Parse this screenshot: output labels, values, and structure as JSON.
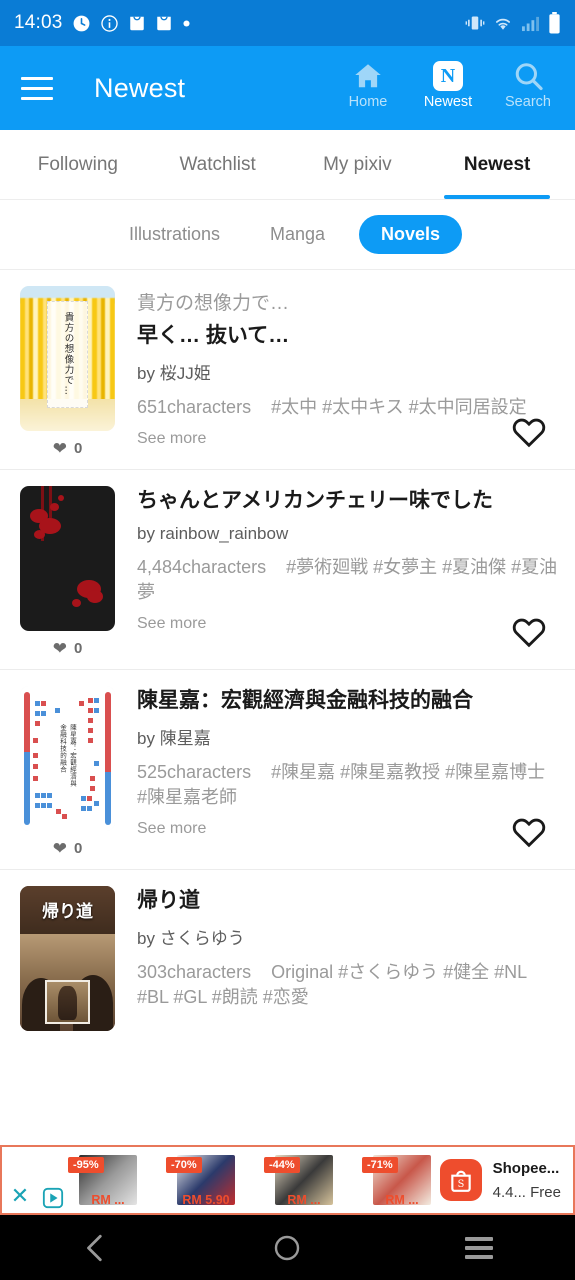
{
  "status_bar": {
    "time": "14:03",
    "left_icons": [
      "timer-icon",
      "info-icon",
      "shopping-bag-icon",
      "shopping-bag-icon",
      "dot-icon"
    ],
    "right_icons": [
      "vibrate-icon",
      "wifi-icon",
      "signal-icon",
      "battery-icon"
    ],
    "background": "#0a7cd5"
  },
  "app_bar": {
    "title": "Newest",
    "menu_icon": "hamburger-icon",
    "background": "#0d9bf5",
    "actions": [
      {
        "label": "Home",
        "icon": "home-icon",
        "active": false
      },
      {
        "label": "Newest",
        "icon": "newest-n-icon",
        "active": true
      },
      {
        "label": "Search",
        "icon": "search-icon",
        "active": false
      }
    ]
  },
  "tabs": [
    {
      "label": "Following",
      "selected": false
    },
    {
      "label": "Watchlist",
      "selected": false
    },
    {
      "label": "My pixiv",
      "selected": false
    },
    {
      "label": "Newest",
      "selected": true
    }
  ],
  "filter_chips": [
    {
      "label": "Illustrations",
      "selected": false
    },
    {
      "label": "Manga",
      "selected": false
    },
    {
      "label": "Novels",
      "selected": true
    }
  ],
  "accent_color": "#0d9bf5",
  "novels": [
    {
      "series": "貴方の想像力で…",
      "title": "早く… 抜いて…",
      "author_prefix": "by",
      "author": "桜JJ姫",
      "characters": "651characters",
      "tags": "#太中  #太中キス  #太中同居設定",
      "see_more": "See more",
      "like_count": "0",
      "thumb_text": "貴方の想像力で…",
      "thumb_art": "ginkgo-avenue"
    },
    {
      "series": "",
      "title": "ちゃんとアメリカンチェリー味でした",
      "author_prefix": "by",
      "author": "rainbow_rainbow",
      "characters": "4,484characters",
      "tags": "#夢術廻戦  #女夢主  #夏油傑  #夏油夢",
      "see_more": "See more",
      "like_count": "0",
      "thumb_text": "",
      "thumb_art": "blood-splatter"
    },
    {
      "series": "",
      "title": "陳星嘉：宏觀經濟與金融科技的融合",
      "author_prefix": "by",
      "author": "陳星嘉",
      "characters": "525characters",
      "tags": "#陳星嘉  #陳星嘉教授  #陳星嘉博士  #陳星嘉老師",
      "see_more": "See more",
      "like_count": "0",
      "thumb_text": "陳星嘉：宏觀經濟與金融科技的融合",
      "thumb_art": "dots-cover"
    },
    {
      "series": "",
      "title": "帰り道",
      "author_prefix": "by",
      "author": "さくらゆう",
      "characters": "303characters",
      "tags": "Original  #さくらゆう  #健全  #NL  #BL  #GL  #朗読  #恋愛",
      "see_more": "",
      "like_count": "",
      "thumb_text": "帰り道",
      "thumb_art": "road-photo"
    }
  ],
  "ad": {
    "close_icon": "close-x-icon",
    "adchoices_icon": "adchoices-icon",
    "border_color": "#e8775a",
    "products": [
      {
        "discount": "-95%",
        "price": "RM ..."
      },
      {
        "discount": "-70%",
        "price": "RM 5.90"
      },
      {
        "discount": "-44%",
        "price": "RM ..."
      },
      {
        "discount": "-71%",
        "price": "RM ..."
      }
    ],
    "app_name": "Shopee...",
    "app_sub": "4.4... Free",
    "app_icon": "shopee-bag-icon",
    "brand_color": "#ee4d2d"
  },
  "nav_bar": {
    "buttons": [
      {
        "name": "back-button",
        "icon": "chevron-left-icon"
      },
      {
        "name": "home-button",
        "icon": "circle-icon"
      },
      {
        "name": "recents-button",
        "icon": "menu-lines-icon"
      }
    ],
    "background": "#000000"
  }
}
